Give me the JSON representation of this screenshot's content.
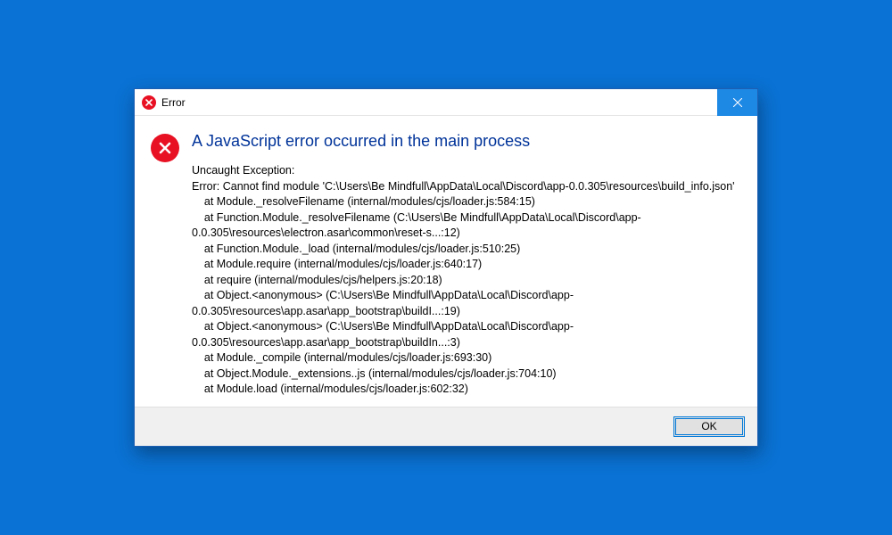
{
  "titlebar": {
    "title": "Error"
  },
  "dialog": {
    "heading": "A JavaScript error occurred in the main process",
    "body_text": "Uncaught Exception:\nError: Cannot find module 'C:\\Users\\Be Mindfull\\AppData\\Local\\Discord\\app-0.0.305\\resources\\build_info.json'\n    at Module._resolveFilename (internal/modules/cjs/loader.js:584:15)\n    at Function.Module._resolveFilename (C:\\Users\\Be Mindfull\\AppData\\Local\\Discord\\app-0.0.305\\resources\\electron.asar\\common\\reset-s...:12)\n    at Function.Module._load (internal/modules/cjs/loader.js:510:25)\n    at Module.require (internal/modules/cjs/loader.js:640:17)\n    at require (internal/modules/cjs/helpers.js:20:18)\n    at Object.<anonymous> (C:\\Users\\Be Mindfull\\AppData\\Local\\Discord\\app-0.0.305\\resources\\app.asar\\app_bootstrap\\buildI...:19)\n    at Object.<anonymous> (C:\\Users\\Be Mindfull\\AppData\\Local\\Discord\\app-0.0.305\\resources\\app.asar\\app_bootstrap\\buildIn...:3)\n    at Module._compile (internal/modules/cjs/loader.js:693:30)\n    at Object.Module._extensions..js (internal/modules/cjs/loader.js:704:10)\n    at Module.load (internal/modules/cjs/loader.js:602:32)"
  },
  "buttons": {
    "ok_label": "OK"
  },
  "icons": {
    "titlebar_error": "error-circle-x",
    "content_error": "error-circle-x",
    "close": "close-x"
  }
}
